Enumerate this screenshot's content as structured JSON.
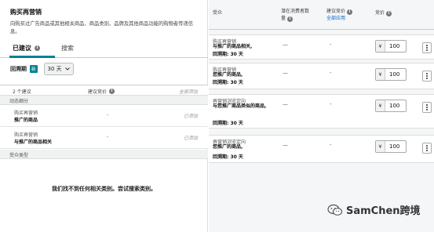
{
  "left": {
    "title": "购买再营销",
    "description": "向购买过广告商品或其他相关商品、商品类别、品牌及其他商品功能的购物者传递信息。",
    "tabs": [
      {
        "label": "已建议",
        "active": true
      },
      {
        "label": "搜索",
        "active": false
      }
    ],
    "lookback": {
      "label": "回溯期",
      "badge": "新",
      "value": "30 天"
    },
    "table_header": {
      "count": "2 个建议",
      "bid": "建议竞价",
      "add_all": "全部添加"
    },
    "group1_label": "动态细分",
    "rows": [
      {
        "line1": "购买再营销",
        "line2": "推广的商品",
        "bid": "-",
        "status": "已添加"
      },
      {
        "line1": "购买再营销",
        "line2": "与推广的商品相关",
        "bid": "-",
        "status": "已添加"
      }
    ],
    "group2_label": "受众类型",
    "empty_message": "我们找不到任何相关类别。尝试搜索类别。"
  },
  "right": {
    "headers": {
      "audience": "受众",
      "potential_line1": "潜在消费者数",
      "potential_line2": "量",
      "suggested_bid": "建议竞价",
      "apply_all": "全部应用",
      "bid": "竞价"
    },
    "cards": [
      {
        "t1": "购买再营销",
        "t2": "与推广的商品相关,",
        "t3": "回溯期: 30 天",
        "potential": "—",
        "suggested": "-",
        "currency": "¥",
        "bid": "100"
      },
      {
        "t1": "购买再营销",
        "t2": "您推广的商品,",
        "t3": "回溯期: 30 天",
        "potential": "—",
        "suggested": "-",
        "currency": "¥",
        "bid": "100"
      },
      {
        "t1": "再营销浏览定向",
        "t2": "与您推广商品类似的商品,",
        "t3": "回溯期: 30 天",
        "potential": "—",
        "suggested": "-",
        "currency": "¥",
        "bid": "100"
      },
      {
        "t1": "再营销浏览定向",
        "t2": "您推广的商品,",
        "t3": "回溯期: 30 天",
        "potential": "—",
        "suggested": "-",
        "currency": "¥",
        "bid": "100"
      }
    ]
  },
  "watermark": "SamChen跨境",
  "icons": {
    "info": "info-icon",
    "chevron": "chevron-down-icon",
    "more": "more-options-icon",
    "wechat": "wechat-icon"
  },
  "colors": {
    "accent": "#008296",
    "link": "#0066c0"
  }
}
